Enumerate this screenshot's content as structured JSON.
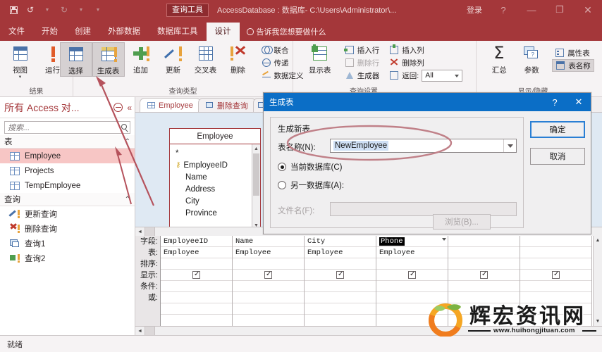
{
  "titlebar": {
    "qat": [
      {
        "name": "save",
        "icon": "save-icon"
      },
      {
        "name": "undo",
        "icon": "undo-icon",
        "label": "↰"
      },
      {
        "name": "redo",
        "icon": "redo-icon",
        "label": "↱"
      },
      {
        "name": "customize",
        "icon": "chevron-down-icon",
        "label": "▾"
      }
    ],
    "context_tab": "查询工具",
    "document_title": "AccessDatabase : 数据库- C:\\Users\\Administrator\\...",
    "sign_in": "登录",
    "help": "?",
    "minimize": "—",
    "restore": "❐",
    "close": "✕"
  },
  "ribbon": {
    "tabs": [
      {
        "label": "文件",
        "active": false
      },
      {
        "label": "开始",
        "active": false
      },
      {
        "label": "创建",
        "active": false
      },
      {
        "label": "外部数据",
        "active": false
      },
      {
        "label": "数据库工具",
        "active": false
      },
      {
        "label": "设计",
        "active": true
      }
    ],
    "tell_me": "告诉我您想要做什么",
    "groups": [
      {
        "label": "结果",
        "buttons": [
          {
            "label": "视图",
            "icon": "view-table-icon",
            "selected": false,
            "dropdown": true
          },
          {
            "label": "运行",
            "icon": "run-exclamation-icon",
            "selected": false
          }
        ]
      },
      {
        "label": "查询类型",
        "buttons": [
          {
            "label": "选择",
            "icon": "select-query-icon",
            "selected": true
          },
          {
            "label": "生成表",
            "icon": "make-table-query-icon",
            "selected": true
          },
          {
            "label": "追加",
            "icon": "append-query-icon",
            "selected": false
          },
          {
            "label": "更新",
            "icon": "update-query-icon",
            "selected": false
          },
          {
            "label": "交叉表",
            "icon": "crosstab-query-icon",
            "selected": false
          },
          {
            "label": "删除",
            "icon": "delete-query-icon",
            "selected": false
          }
        ],
        "small_buttons": [
          {
            "label": "联合",
            "icon": "union-icon"
          },
          {
            "label": "传递",
            "icon": "passthrough-icon"
          },
          {
            "label": "数据定义",
            "icon": "data-definition-icon"
          }
        ]
      },
      {
        "label": "查询设置",
        "buttons": [
          {
            "label": "显示表",
            "icon": "show-table-icon",
            "selected": false
          }
        ],
        "small_buttons": [
          {
            "label": "插入行",
            "icon": "insert-row-icon",
            "disabled": false
          },
          {
            "label": "删除行",
            "icon": "delete-row-icon",
            "disabled": true
          },
          {
            "label": "生成器",
            "icon": "builder-icon",
            "disabled": false
          },
          {
            "label": "插入列",
            "icon": "insert-column-icon",
            "disabled": false
          },
          {
            "label": "删除列",
            "icon": "delete-column-icon",
            "disabled": false
          }
        ],
        "return_label": "返回:",
        "return_value": "All"
      },
      {
        "label": "显示/隐藏",
        "buttons": [
          {
            "label": "汇总",
            "icon": "totals-sigma-icon",
            "selected": false
          },
          {
            "label": "参数",
            "icon": "parameters-icon",
            "selected": false
          }
        ],
        "small_buttons": [
          {
            "label": "属性表",
            "icon": "property-sheet-icon",
            "selected": false
          },
          {
            "label": "表名称",
            "icon": "table-names-icon",
            "selected": true
          }
        ]
      }
    ]
  },
  "navpane": {
    "title": "所有 Access 对...",
    "search_placeholder": "搜索...",
    "groups": [
      {
        "label": "表",
        "items": [
          {
            "label": "Employee",
            "icon": "table-icon",
            "selected": true
          },
          {
            "label": "Projects",
            "icon": "table-icon",
            "selected": false
          },
          {
            "label": "TempEmployee",
            "icon": "table-icon",
            "selected": false
          }
        ]
      },
      {
        "label": "查询",
        "items": [
          {
            "label": "更新查询",
            "icon": "update-query-icon",
            "selected": false
          },
          {
            "label": "删除查询",
            "icon": "delete-query-icon",
            "selected": false
          },
          {
            "label": "查询1",
            "icon": "select-query-icon",
            "selected": false
          },
          {
            "label": "查询2",
            "icon": "append-query-icon",
            "selected": false
          }
        ]
      }
    ]
  },
  "main": {
    "doc_tabs": [
      {
        "label": "Employee",
        "active": true,
        "icon": "table-icon"
      },
      {
        "label": "删除查询",
        "active": false,
        "icon": "query-icon"
      },
      {
        "label": "",
        "active": false,
        "icon": "query-icon"
      }
    ],
    "table_box": {
      "title": "Employee",
      "fields": [
        "*",
        "EmployeeID",
        "Name",
        "Address",
        "City",
        "Province"
      ],
      "key_field": "EmployeeID"
    },
    "grid": {
      "row_labels": [
        "字段:",
        "表:",
        "排序:",
        "显示:",
        "条件:",
        "或:"
      ],
      "columns": [
        {
          "field": "EmployeeID",
          "table": "Employee",
          "sort": "",
          "show": true,
          "criteria": "",
          "or": "",
          "selected": false
        },
        {
          "field": "Name",
          "table": "Employee",
          "sort": "",
          "show": true,
          "criteria": "",
          "or": "",
          "selected": false
        },
        {
          "field": "City",
          "table": "Employee",
          "sort": "",
          "show": true,
          "criteria": "",
          "or": "",
          "selected": false
        },
        {
          "field": "Phone",
          "table": "Employee",
          "sort": "",
          "show": true,
          "criteria": "",
          "or": "",
          "selected": true
        },
        {
          "field": "",
          "table": "",
          "sort": "",
          "show": true,
          "criteria": "",
          "or": "",
          "selected": false
        },
        {
          "field": "",
          "table": "",
          "sort": "",
          "show": true,
          "criteria": "",
          "or": "",
          "selected": false
        }
      ]
    }
  },
  "dialog": {
    "title": "生成表",
    "help_btn": "?",
    "close_btn": "✕",
    "section_label": "生成新表",
    "table_name_label": "表名称(N):",
    "table_name_value": "NewEmployee",
    "radio_current_db": "当前数据库(C)",
    "radio_other_db": "另一数据库(A):",
    "file_name_label": "文件名(F):",
    "file_name_value": "",
    "browse_label": "浏览(B)...",
    "ok_label": "确定",
    "cancel_label": "取消",
    "selected_option": "current"
  },
  "statusbar": {
    "text": "就绪"
  },
  "watermark": {
    "text": "辉宏资讯网",
    "url": "www.huihongjituan.com"
  },
  "colors": {
    "ribbon_red": "#a4373a",
    "dialog_blue": "#0b6ec6",
    "nav_selected": "#f7c6c5",
    "annotation_red": "#b5525c",
    "query_pane_blue": "#dfe9f3"
  }
}
